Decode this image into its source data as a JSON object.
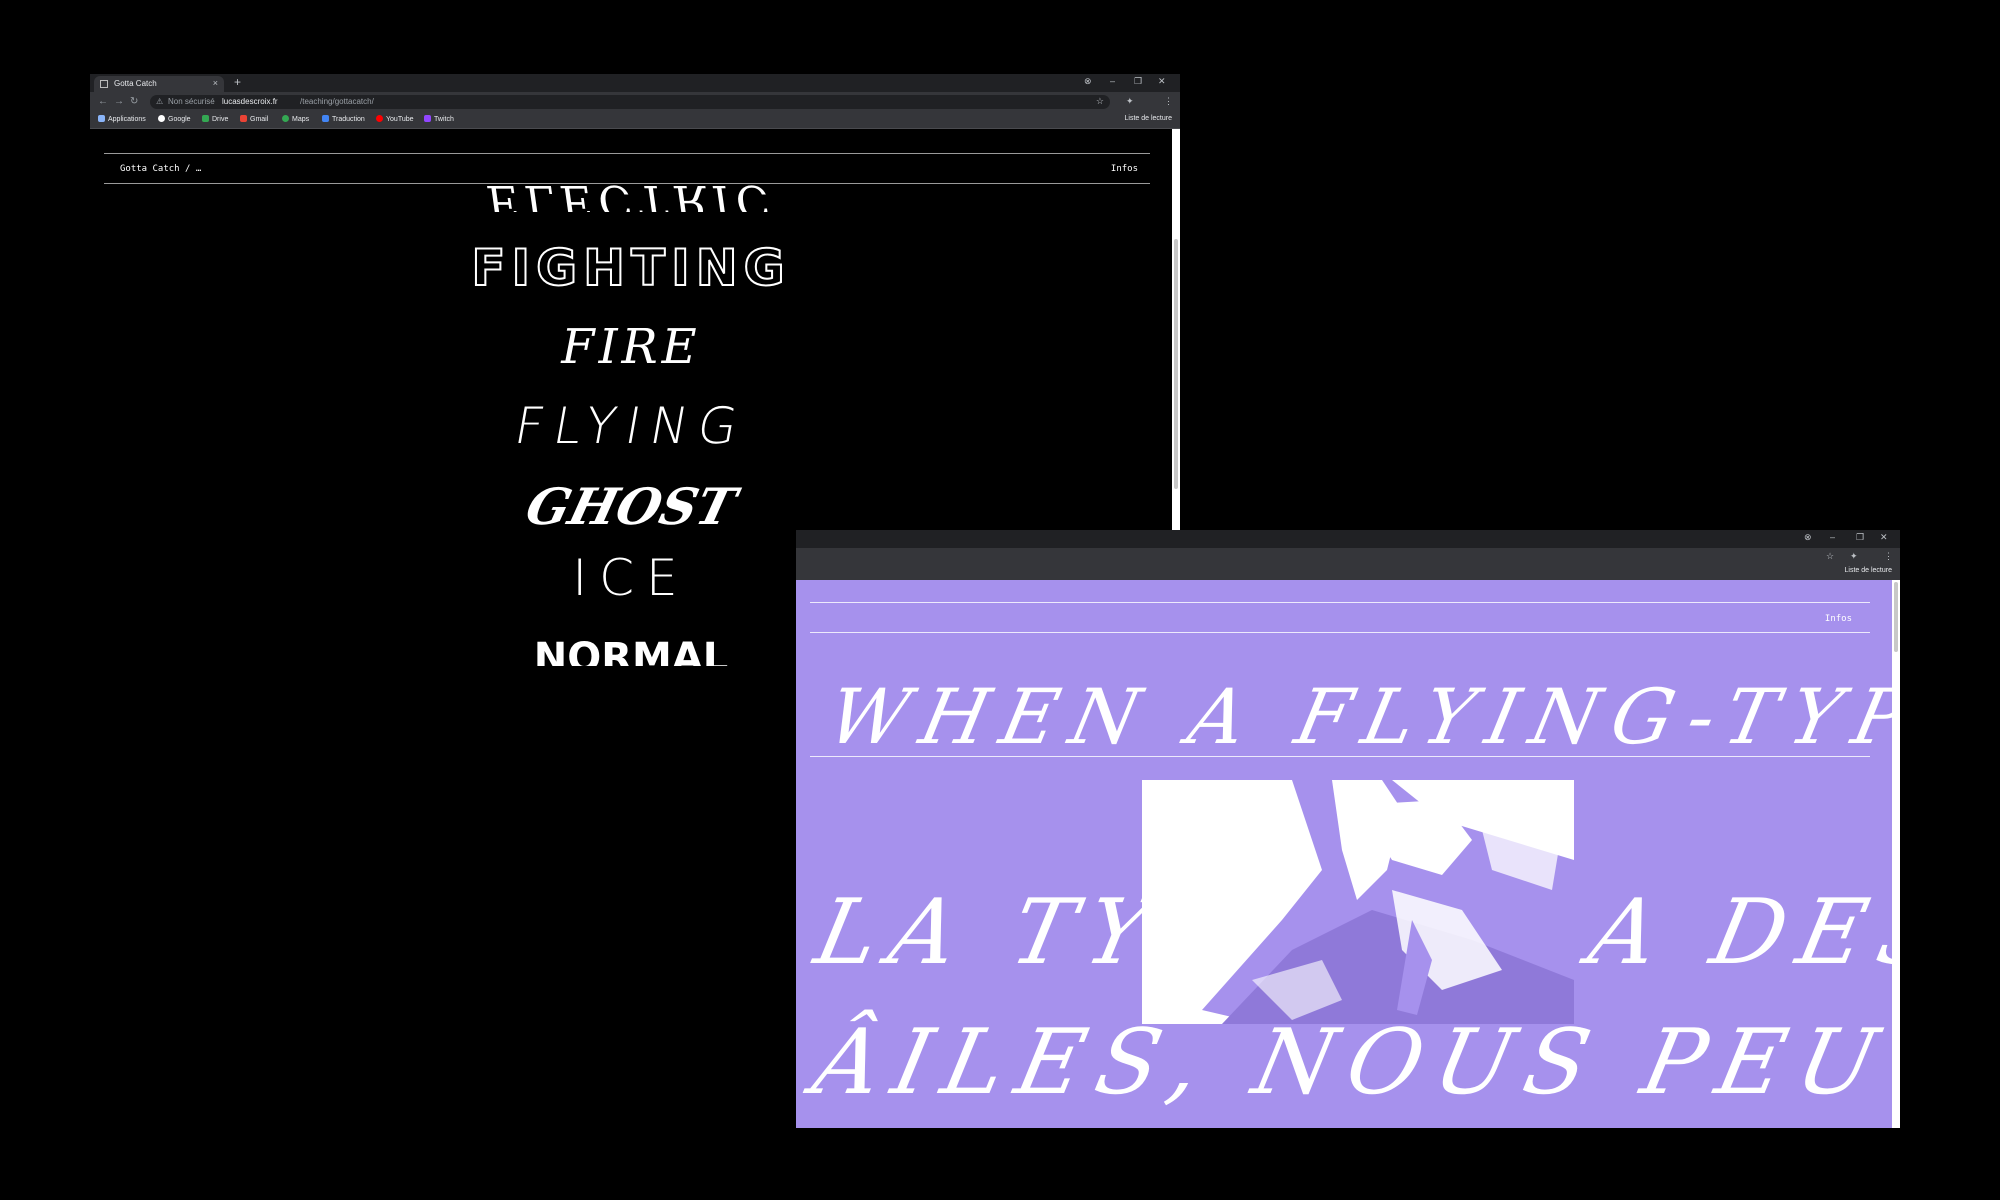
{
  "window1": {
    "tab_title": "Gotta Catch",
    "tab_close": "×",
    "new_tab": "+",
    "controls": [
      "⊗",
      "–",
      "❐",
      "✕"
    ],
    "nav": [
      "←",
      "→",
      "↻"
    ],
    "address": {
      "warning": "⚠",
      "security": "Non sécurisé",
      "host": "lucasdescroix.fr",
      "path": "/teaching/gottacatch/",
      "star": "☆"
    },
    "toolbar_icons": [
      "✦",
      "⋮"
    ],
    "bookmarks": [
      {
        "label": "Applications",
        "color": "#8ab4f8"
      },
      {
        "label": "Google",
        "color": "#ffffff"
      },
      {
        "label": "Drive",
        "color": "#34a853"
      },
      {
        "label": "Gmail",
        "color": "#ea4335"
      },
      {
        "label": "Maps",
        "color": "#34a853"
      },
      {
        "label": "Traduction",
        "color": "#4285f4"
      },
      {
        "label": "YouTube",
        "color": "#ff0000"
      },
      {
        "label": "Twitch",
        "color": "#9146ff"
      }
    ],
    "reading_list": "Liste de lecture",
    "page": {
      "site_title": "Gotta Catch / …",
      "infos": "Infos",
      "types": [
        "ELECTRIC",
        "FIGHTING",
        "FIRE",
        "FLYING",
        "GHOST",
        "ICE",
        "NORMAL"
      ]
    }
  },
  "window2": {
    "controls": [
      "⊗",
      "–",
      "❐",
      "✕"
    ],
    "toolbar_icons": [
      "☆",
      "✦",
      "⋮"
    ],
    "reading_list": "Liste de lecture",
    "page": {
      "infos": "Infos",
      "headline": "WHEN A FLYING-TYPE L",
      "line2": "LA TYPE",
      "line2b": "A DES",
      "line3": "ÂILES, NOUS PEUT"
    },
    "accent": "#a691ed"
  }
}
